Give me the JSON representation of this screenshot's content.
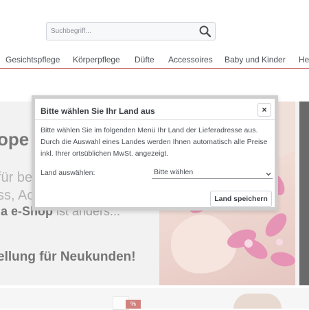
{
  "search": {
    "placeholder": "Suchbegriff..."
  },
  "nav": {
    "items": [
      {
        "label": "Gesichtspflege"
      },
      {
        "label": "Körperpflege"
      },
      {
        "label": "Düfte"
      },
      {
        "label": "Accessoires"
      },
      {
        "label": "Baby und Kinder"
      },
      {
        "label": "He"
      }
    ]
  },
  "hero": {
    "line1": "ope",
    "line2": "für be",
    "line3": "ss, Ac",
    "line4_bold": "ia e-Shop",
    "line4_rest": " ist anders...",
    "line5": "ellung für Neukunden!"
  },
  "promo": {
    "tag": "%"
  },
  "modal": {
    "title": "Bitte wählen Sie Ihr Land aus",
    "close_label": "×",
    "description": "Bitte wählen Sie im folgenden Menü Ihr Land der Lieferadresse aus. Durch die Auswahl eines Landes werden Ihnen automatisch alle Preise inkl. Ihrer ortsüblichen MwSt. angezeigt.",
    "field_label": "Land auswählen:",
    "select_value": "Bitte wählen",
    "save_label": "Land speichern"
  },
  "colors": {
    "accent": "#b9403b",
    "text": "#4a4f55",
    "modal_border": "#cfcfcf"
  }
}
